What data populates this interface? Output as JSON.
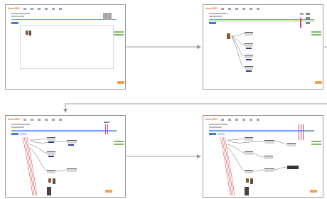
{
  "app": {
    "logo": "Node-RED"
  },
  "screens": [
    {
      "id": "step-1",
      "caption": ""
    },
    {
      "id": "step-2",
      "caption": ""
    },
    {
      "id": "step-3",
      "caption": ""
    },
    {
      "id": "step-4",
      "caption": ""
    }
  ],
  "colors": {
    "logo": "#e8701e",
    "rule_blue": "#5aa7d6",
    "rule_green": "#7dbb64",
    "button_blue": "#4b7bd1",
    "deploy_orange": "#f0a04b",
    "wire_red": "#d23b3b",
    "arrow_grey": "#9a9a9a"
  }
}
